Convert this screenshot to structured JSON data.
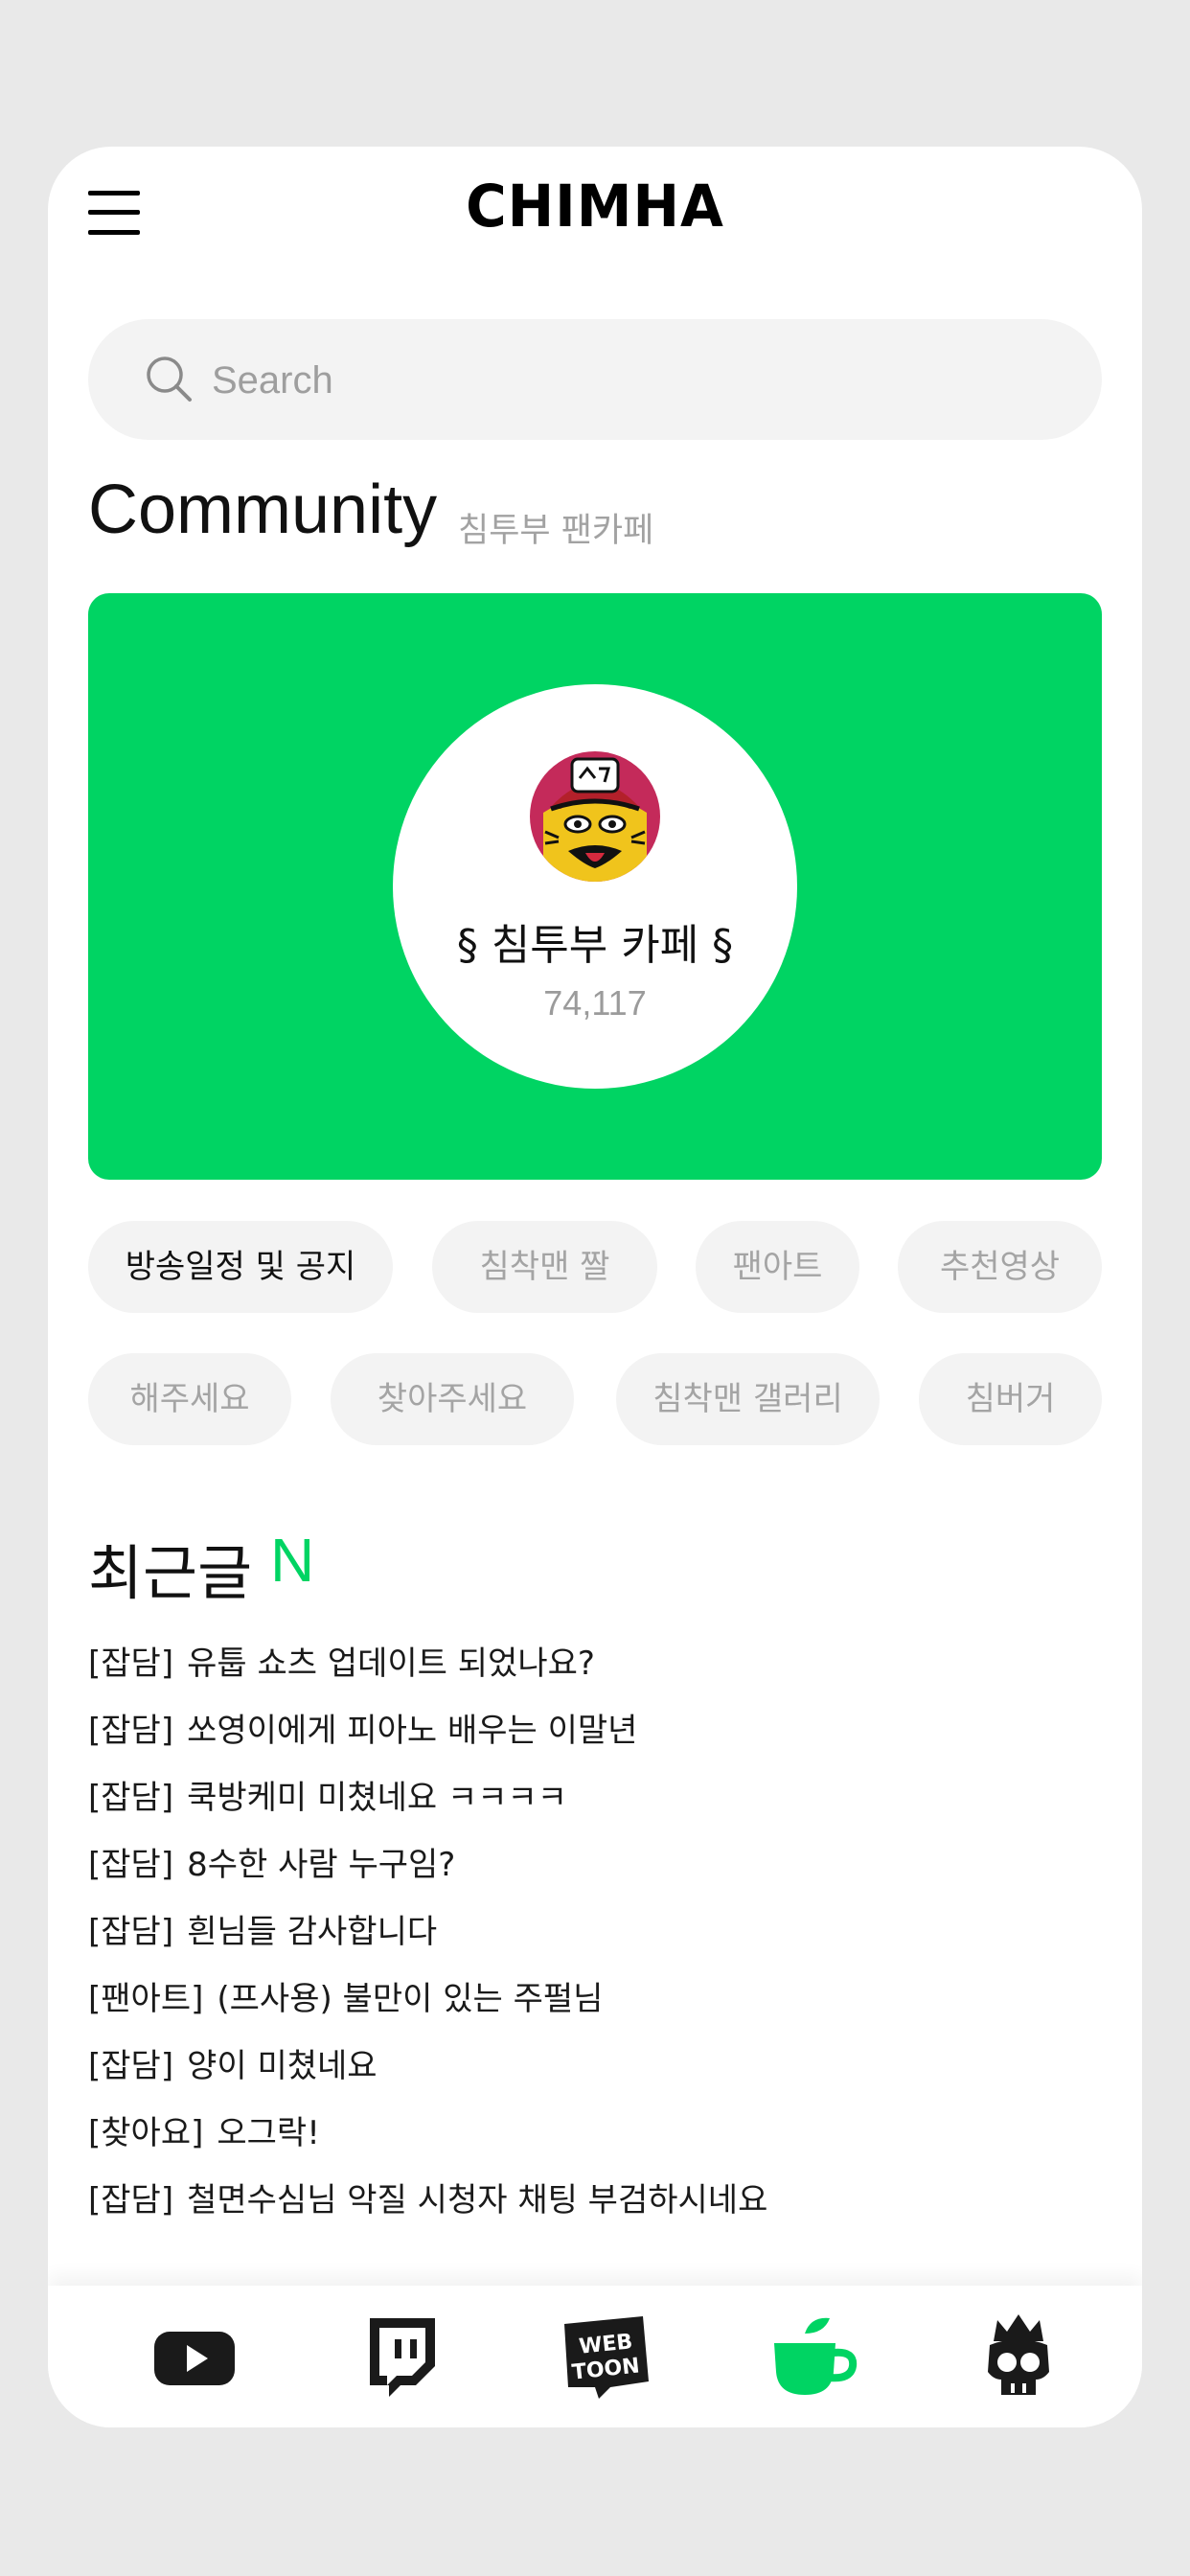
{
  "header": {
    "title": "CHIMHA",
    "menu_icon": "hamburger-menu-icon"
  },
  "search": {
    "placeholder": "Search",
    "value": "",
    "icon": "search-icon"
  },
  "community": {
    "title": "Community",
    "subtitle": "침투부 팬카페",
    "banner_color": "#00d463",
    "cafe": {
      "name": "§ 침투부 카페 §",
      "member_count": "74,117",
      "avatar_icon": "cafe-avatar-icon"
    }
  },
  "categories": [
    {
      "label": "방송일정 및 공지",
      "active": true
    },
    {
      "label": "침착맨 짤",
      "active": false
    },
    {
      "label": "팬아트",
      "active": false
    },
    {
      "label": "추천영상",
      "active": false
    },
    {
      "label": "해주세요",
      "active": false
    },
    {
      "label": "찾아주세요",
      "active": false
    },
    {
      "label": "침착맨 갤러리",
      "active": false
    },
    {
      "label": "침버거",
      "active": false
    }
  ],
  "recent": {
    "title": "최근글",
    "badge": "N",
    "badge_color": "#00d463",
    "posts": [
      {
        "category": "[잡담]",
        "title": "유툽 쇼츠 업데이트 되었나요?"
      },
      {
        "category": "[잡담]",
        "title": "쏘영이에게 피아노 배우는 이말년"
      },
      {
        "category": "[잡담]",
        "title": "쿡방케미 미쳤네요 ㅋㅋㅋㅋ"
      },
      {
        "category": "[잡담]",
        "title": "8수한 사람 누구임?"
      },
      {
        "category": "[잡담]",
        "title": "흰님들 감사합니다"
      },
      {
        "category": "[팬아트]",
        "title": "(프사용) 불만이 있는 주펄님"
      },
      {
        "category": "[잡담]",
        "title": "양이 미쳤네요"
      },
      {
        "category": "[찾아요]",
        "title": "오그락!"
      },
      {
        "category": "[잡담]",
        "title": "철면수심님 악질 시청자 채팅 부검하시네요"
      }
    ]
  },
  "bottom_nav": [
    {
      "icon": "youtube-icon",
      "active": false
    },
    {
      "icon": "twitch-icon",
      "active": false
    },
    {
      "icon": "webtoon-icon",
      "label": "WEB TOON",
      "active": false
    },
    {
      "icon": "cafe-cup-icon",
      "active": true
    },
    {
      "icon": "skull-icon",
      "active": false
    }
  ],
  "colors": {
    "accent": "#00d463",
    "chip_bg": "#f3f3f3",
    "page_bg": "#e9e9e9"
  }
}
